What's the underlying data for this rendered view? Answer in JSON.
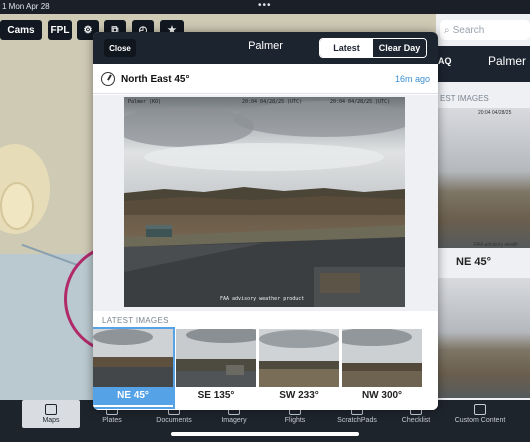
{
  "status_bar": {
    "time": "1  Mon Apr 28",
    "dots": "•••"
  },
  "toolbar": {
    "cams_label": "Cams",
    "fpl_label": "FPL"
  },
  "modal": {
    "close_label": "Close",
    "title": "Palmer",
    "segments": {
      "latest": "Latest",
      "clear_day": "Clear Day"
    },
    "camera": {
      "name": "North East 45°",
      "age": "16m ago"
    },
    "image_stamp_left": "Palmer (KO)",
    "image_stamp_mid": "20:04 04/28/25 (UTC)",
    "image_stamp_right": "20:04 04/28/25 (UTC)",
    "image_footer": "FAA advisory weather product",
    "latest_images_label": "LATEST IMAGES",
    "thumbs": [
      {
        "label": "NE 45°",
        "selected": true
      },
      {
        "label": "SE 135°",
        "selected": false
      },
      {
        "label": "SW 233°",
        "selected": false
      },
      {
        "label": "NW 300°",
        "selected": false
      }
    ]
  },
  "right_panel": {
    "search_placeholder": "Search",
    "header_code": "AQ",
    "header_name": "Palmer",
    "latest_images_label": "EST IMAGES",
    "thumb_label": "NE 45°",
    "thumb_stamp": "20:04 04/28/25",
    "thumb_stamp2": "FAA advisory weath"
  },
  "tabbar": {
    "items": [
      {
        "label": "Maps",
        "active": true
      },
      {
        "label": "Plates",
        "active": false
      },
      {
        "label": "Documents",
        "active": false
      },
      {
        "label": "Imagery",
        "active": false
      },
      {
        "label": "Flights",
        "active": false
      },
      {
        "label": "ScratchPads",
        "active": false
      },
      {
        "label": "Checklist",
        "active": false
      },
      {
        "label": "Custom Content",
        "active": false
      }
    ]
  },
  "colors": {
    "accent_blue": "#55a2e6",
    "link_blue": "#3a8fd6",
    "header_dark": "#1c2430"
  }
}
